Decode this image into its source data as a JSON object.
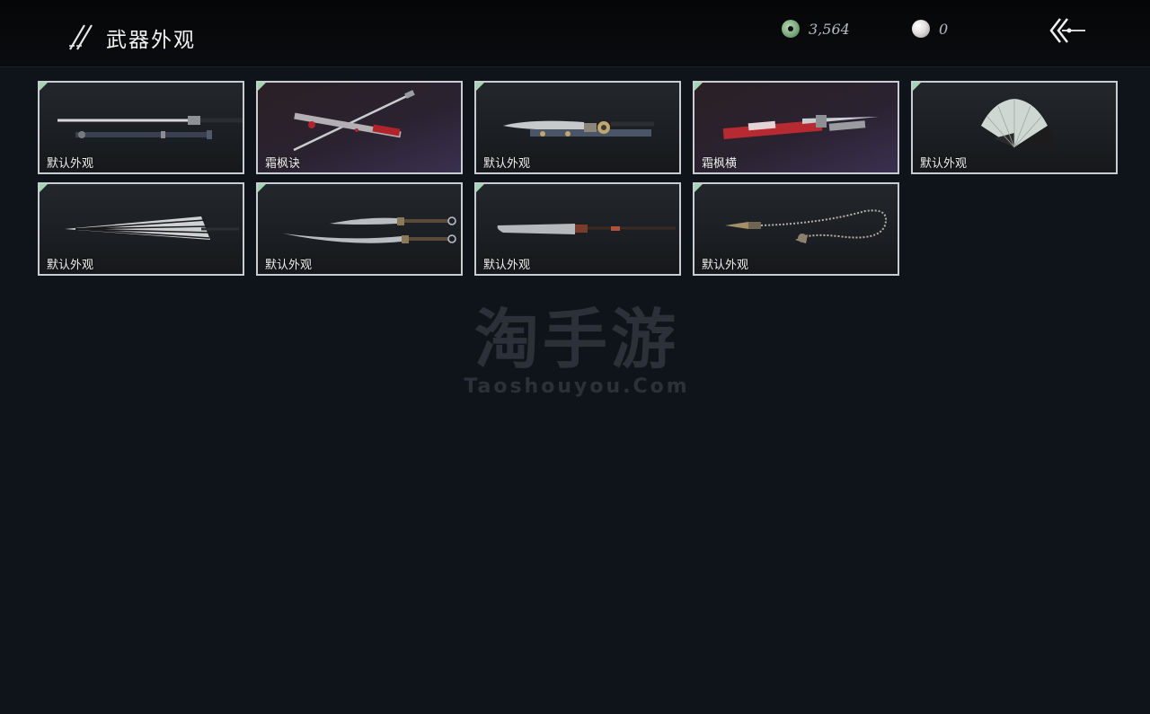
{
  "header": {
    "title": "武器外观",
    "title_icon": "twin-swords-icon",
    "currencies": [
      {
        "icon": "jade-coin-icon",
        "value": "3,564"
      },
      {
        "icon": "pearl-icon",
        "value": "0"
      }
    ],
    "back_icon": "back-arrow-icon"
  },
  "skins": [
    {
      "label": "默认外观",
      "weapon": "sword-and-scabbard-icon"
    },
    {
      "label": "霜枫诀",
      "weapon": "red-sword-icon"
    },
    {
      "label": "默认外观",
      "weapon": "ornate-blade-icon"
    },
    {
      "label": "霜枫横",
      "weapon": "red-blade-icon"
    },
    {
      "label": "默认外观",
      "weapon": "folding-fan-icon"
    },
    {
      "label": "默认外观",
      "weapon": "umbrella-icon"
    },
    {
      "label": "默认外观",
      "weapon": "twin-sabres-icon"
    },
    {
      "label": "默认外观",
      "weapon": "glaive-icon"
    },
    {
      "label": "默认外观",
      "weapon": "rope-dart-icon"
    }
  ],
  "watermark": {
    "main": "淘手游",
    "sub": "Taoshouyou.Com"
  },
  "colors": {
    "background": "#0f131a",
    "card_border": "#c9cdd1",
    "corner_accent": "#9fd6b0"
  }
}
